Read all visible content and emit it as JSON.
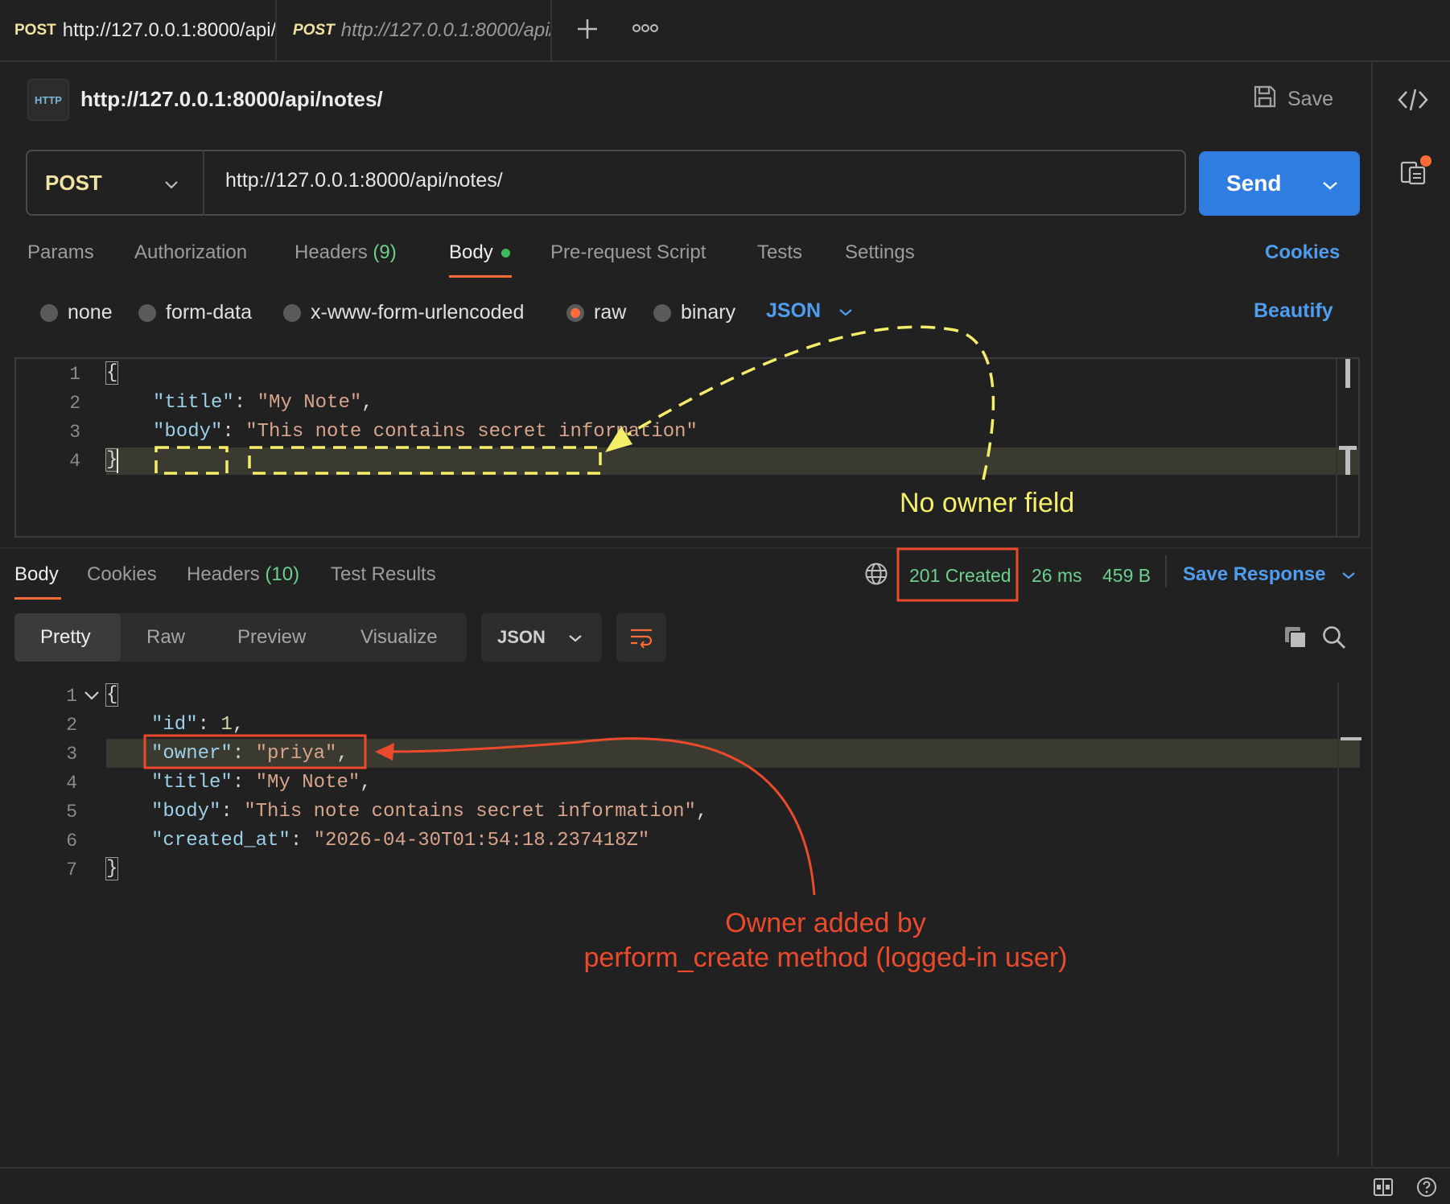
{
  "tabs": [
    {
      "method": "POST",
      "url": "http://127.0.0.1:8000/api/"
    },
    {
      "method": "POST",
      "url": "http://127.0.0.1:8000/api/"
    }
  ],
  "request": {
    "title": "http://127.0.0.1:8000/api/notes/",
    "save_label": "Save",
    "method": "POST",
    "url": "http://127.0.0.1:8000/api/notes/",
    "send_label": "Send",
    "tabs": {
      "params": "Params",
      "authorization": "Authorization",
      "headers": "Headers",
      "headers_count": "(9)",
      "body": "Body",
      "prerequest": "Pre-request Script",
      "tests": "Tests",
      "settings": "Settings"
    },
    "cookies_label": "Cookies",
    "body_types": [
      "none",
      "form-data",
      "x-www-form-urlencoded",
      "raw",
      "binary"
    ],
    "body_type_selected": "raw",
    "format": "JSON",
    "beautify_label": "Beautify",
    "code_lines": [
      {
        "n": "1",
        "text": "{"
      },
      {
        "n": "2",
        "key": "\"title\"",
        "value": "\"My Note\""
      },
      {
        "n": "3",
        "key": "\"body\"",
        "value": "\"This note contains secret information\""
      },
      {
        "n": "4",
        "text": "}"
      }
    ]
  },
  "response": {
    "tabs": {
      "body": "Body",
      "cookies": "Cookies",
      "headers": "Headers",
      "headers_count": "(10)",
      "test_results": "Test Results"
    },
    "status": "201 Created",
    "time": "26 ms",
    "size": "459 B",
    "save_response": "Save Response",
    "views": [
      "Pretty",
      "Raw",
      "Preview",
      "Visualize"
    ],
    "format": "JSON",
    "code_lines": [
      {
        "n": "1",
        "text": "{"
      },
      {
        "n": "2",
        "key": "\"id\"",
        "value": "1"
      },
      {
        "n": "3",
        "key": "\"owner\"",
        "value": "\"priya\""
      },
      {
        "n": "4",
        "key": "\"title\"",
        "value": "\"My Note\""
      },
      {
        "n": "5",
        "key": "\"body\"",
        "value": "\"This note contains secret information\""
      },
      {
        "n": "6",
        "key": "\"created_at\"",
        "value": "\"2026-04-30T01:54:18.237418Z\""
      },
      {
        "n": "7",
        "text": "}"
      }
    ]
  },
  "annotations": {
    "no_owner": "No owner field",
    "owner_added_line1": "Owner added by",
    "owner_added_line2": "perform_create method (logged-in user)"
  },
  "colors": {
    "accent": "#ff6c37",
    "link": "#4f9dee",
    "send": "#2f7de1",
    "status_ok": "#6dcf8e",
    "annot_yellow": "#f5ee6b",
    "annot_red": "#ec4a2c"
  },
  "icons": [
    "http-icon",
    "save-icon",
    "chevron-down-icon",
    "plus-icon",
    "more-icon",
    "code-icon",
    "docs-icon",
    "globe-icon",
    "copy-icon",
    "search-icon",
    "wrap-icon",
    "layout-icon",
    "help-icon"
  ]
}
